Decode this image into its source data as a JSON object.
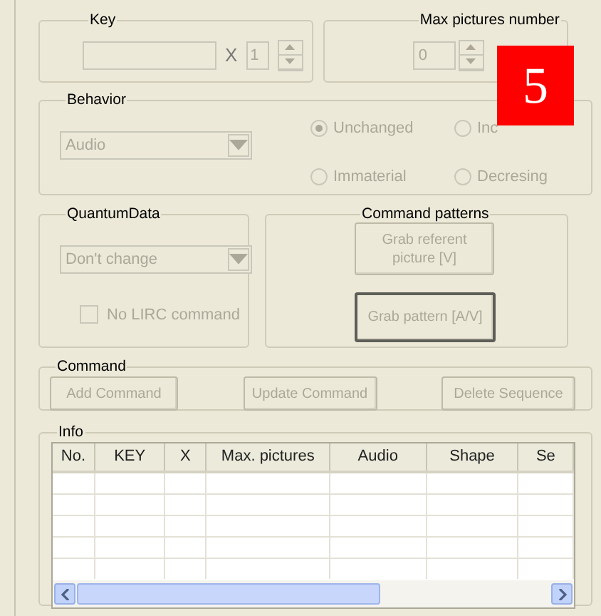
{
  "disabled": true,
  "key_group": {
    "title": "Key",
    "multiplier_sign": "X",
    "count": "1"
  },
  "max_pictures": {
    "title": "Max pictures number",
    "value": "0"
  },
  "behavior": {
    "title": "Behavior",
    "combo": "Audio",
    "options": [
      {
        "label": "Unchanged",
        "selected": true
      },
      {
        "label": "Inc",
        "selected": false
      },
      {
        "label": "Immaterial",
        "selected": false
      },
      {
        "label": "Decresing",
        "selected": false
      }
    ]
  },
  "quantum": {
    "title": "QuantumData",
    "combo": "Don't change",
    "checkbox": {
      "label": "No LIRC command",
      "checked": false
    }
  },
  "patterns": {
    "title": "Command patterns",
    "buttons": [
      {
        "label": "Grab referent picture [V]",
        "default": false
      },
      {
        "label": "Grab pattern [A/V]",
        "default": true
      }
    ]
  },
  "command": {
    "title": "Command",
    "buttons": [
      "Add Command",
      "Update Command",
      "Delete Sequence"
    ]
  },
  "info": {
    "title": "Info",
    "table": {
      "columns": [
        "No.",
        "KEY",
        "X",
        "Max. pictures",
        "Audio",
        "Shape",
        "Se"
      ]
    }
  },
  "badge": "5"
}
